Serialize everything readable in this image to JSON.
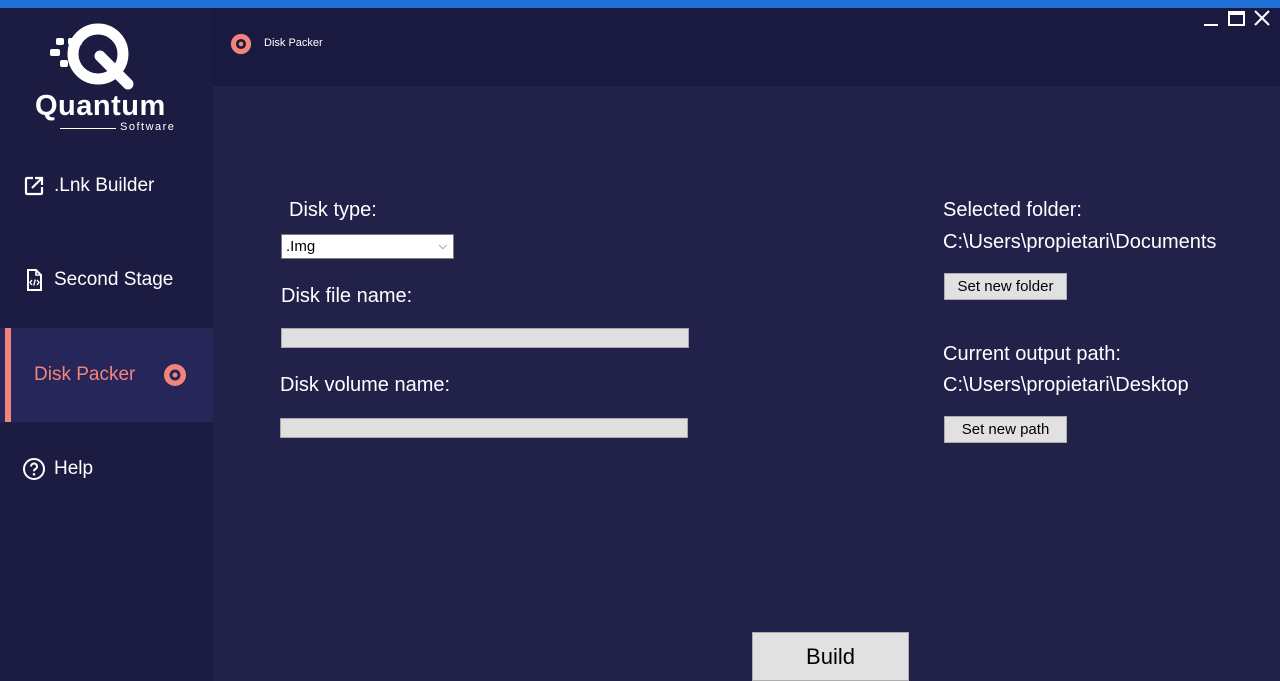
{
  "brand": {
    "name": "Quantum",
    "sub": "Software"
  },
  "sidebar": {
    "items": [
      {
        "label": ".Lnk Builder",
        "icon": "external-link-icon"
      },
      {
        "label": "Second Stage",
        "icon": "code-file-icon"
      },
      {
        "label": "Disk Packer",
        "icon": "disc-icon",
        "active": true
      },
      {
        "label": "Help",
        "icon": "help-circle-icon"
      }
    ]
  },
  "header": {
    "title": "Disk Packer"
  },
  "window_controls": {
    "minimize": "minimize-icon",
    "maximize": "maximize-icon",
    "close": "close-icon"
  },
  "form": {
    "disk_type_label": "Disk type:",
    "disk_type_value": ".Img",
    "disk_file_name_label": "Disk file name:",
    "disk_file_name_value": "",
    "disk_volume_name_label": "Disk volume name:",
    "disk_volume_name_value": ""
  },
  "folder": {
    "selected_label": "Selected folder:",
    "selected_path": "C:\\Users\\propietari\\Documents",
    "set_folder_button": "Set new folder",
    "output_label": "Current output path:",
    "output_path": "C:\\Users\\propietari\\Desktop",
    "set_path_button": "Set new path"
  },
  "build_button": "Build",
  "colors": {
    "accent": "#f2857a",
    "sidebar": "#1c1b42",
    "main": "#22214a",
    "header": "#1a1940",
    "topbar": "#1f6fd6"
  }
}
